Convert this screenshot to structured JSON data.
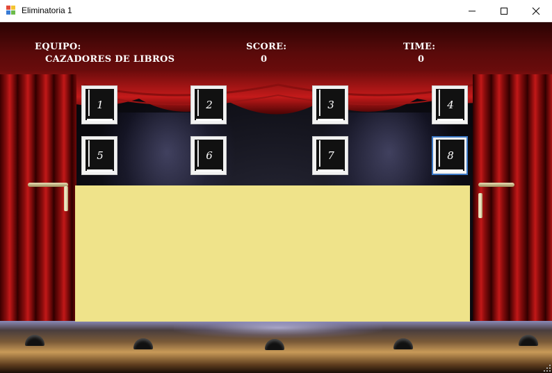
{
  "window": {
    "title": "Eliminatoria 1"
  },
  "header": {
    "team_label": "EQUIPO:",
    "team_name": "CAZADORES DE LIBROS",
    "score_label": "SCORE:",
    "score_value": "0",
    "time_label": "TIME:",
    "time_value": "0"
  },
  "tiles": [
    {
      "label": "1",
      "icon": "book-icon",
      "selected": false
    },
    {
      "label": "2",
      "icon": "book-icon",
      "selected": false
    },
    {
      "label": "3",
      "icon": "book-icon",
      "selected": false
    },
    {
      "label": "4",
      "icon": "book-icon",
      "selected": false
    },
    {
      "label": "5",
      "icon": "book-icon",
      "selected": false
    },
    {
      "label": "6",
      "icon": "book-icon",
      "selected": false
    },
    {
      "label": "7",
      "icon": "book-icon",
      "selected": false
    },
    {
      "label": "8",
      "icon": "book-icon",
      "selected": true
    }
  ],
  "colors": {
    "panel": "#efe38a",
    "curtain": "#c21818",
    "selection_border": "#3b78c6"
  }
}
